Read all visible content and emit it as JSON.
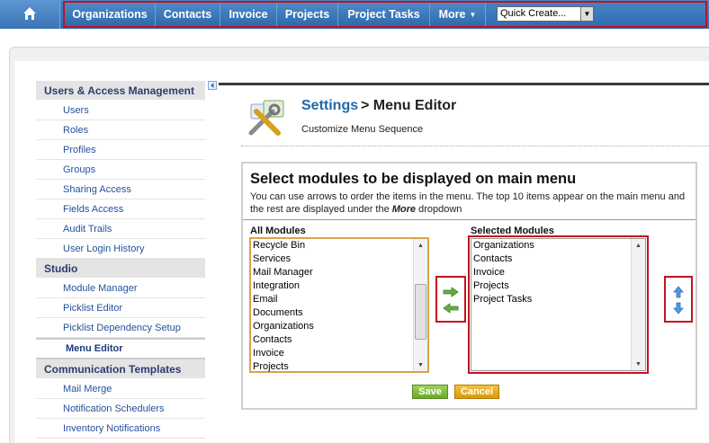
{
  "nav": {
    "home_icon": "home-icon",
    "items": [
      "Organizations",
      "Contacts",
      "Invoice",
      "Projects",
      "Project Tasks"
    ],
    "more_label": "More",
    "quick_create": "Quick Create..."
  },
  "sidebar": {
    "sections": [
      {
        "heading": "Users & Access Management",
        "items": [
          "Users",
          "Roles",
          "Profiles",
          "Groups",
          "Sharing Access",
          "Fields Access",
          "Audit Trails",
          "User Login History"
        ]
      },
      {
        "heading": "Studio",
        "items": [
          "Module Manager",
          "Picklist Editor",
          "Picklist Dependency Setup"
        ]
      },
      {
        "active_item": "Menu Editor"
      },
      {
        "heading": "Communication Templates",
        "items": [
          "Mail Merge",
          "Notification Schedulers",
          "Inventory Notifications"
        ]
      }
    ]
  },
  "header": {
    "settings_link": "Settings",
    "title_rest": "> Menu Editor",
    "subtitle": "Customize Menu Sequence"
  },
  "panel": {
    "title": "Select modules to be displayed on main menu",
    "desc_before": "You can use arrows to order the items in the menu. The top 10 items appear on the main menu and the rest are displayed under the ",
    "desc_emph": "More",
    "desc_after": " dropdown",
    "all_label": "All Modules",
    "selected_label": "Selected Modules",
    "all_modules": [
      "Recycle Bin",
      "Services",
      "Mail Manager",
      "Integration",
      "Email",
      "Documents",
      "Organizations",
      "Contacts",
      "Invoice",
      "Projects"
    ],
    "selected_modules": [
      "Organizations",
      "Contacts",
      "Invoice",
      "Projects",
      "Project Tasks"
    ],
    "save_label": "Save",
    "cancel_label": "Cancel"
  },
  "colors": {
    "nav_blue": "#2f6aad",
    "highlight_red": "#c1121f",
    "save_green": "#6aa829",
    "cancel_orange": "#d99a0e",
    "link_blue": "#24519b"
  }
}
